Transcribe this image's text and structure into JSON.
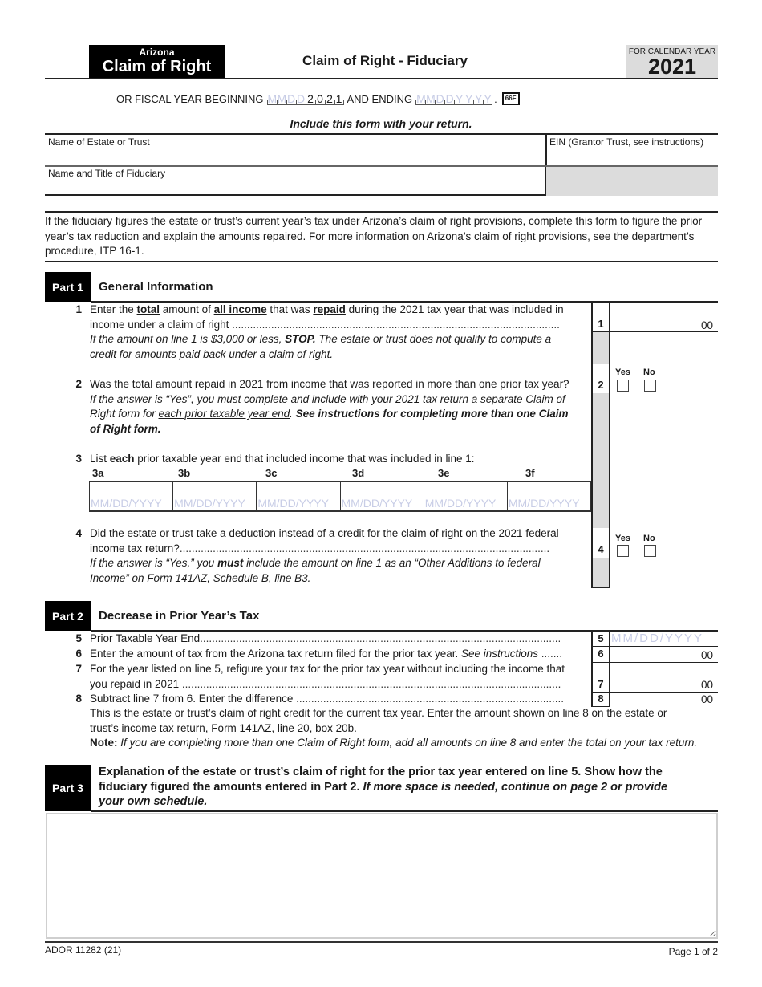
{
  "header": {
    "state": "Arizona",
    "form_name": "Claim of Right",
    "title": "Claim of Right - Fiduciary",
    "calendar_label": "FOR CALENDAR YEAR",
    "year": "2021"
  },
  "fiscal": {
    "beginning_label": "OR FISCAL YEAR BEGINNING",
    "beginning_placeholder": [
      "M",
      "M",
      "D",
      "D"
    ],
    "beginning_year": [
      "2",
      "0",
      "2",
      "1"
    ],
    "ending_label": "AND ENDING",
    "ending_placeholder": [
      "M",
      "M",
      "D",
      "D",
      "Y",
      "Y",
      "Y",
      "Y"
    ],
    "code": "66F"
  },
  "include_note": "Include this form with your return.",
  "identity": {
    "estate_label": "Name of Estate or Trust",
    "estate_value": "",
    "ein_label": "EIN (Grantor Trust, see instructions)",
    "ein_value": "",
    "fiduciary_label": "Name and Title of Fiduciary",
    "fiduciary_value": ""
  },
  "intro": "If the fiduciary figures the estate or trust’s current year’s tax under Arizona’s claim of right provisions, complete this form to figure the prior year’s tax reduction and explain the amounts repaired.  For more information on Arizona’s claim of right provisions, see the department’s procedure, ITP 16-1.",
  "part1": {
    "tag": "Part 1",
    "title": "General Information",
    "line1": {
      "num": "1",
      "t1": "Enter the ",
      "u1": "total",
      "t2": " amount of ",
      "u2": "all income",
      "t3": " that was ",
      "u3": "repaid",
      "t4": " during the 2021 tax year that was included in",
      "t5": "income under a claim of right",
      "dots": " .............................................................................................................",
      "note1": "If the amount on line 1 is $3,000 or less, ",
      "note_stop": "STOP.",
      "note2": "  The estate or trust does not qualify to compute a",
      "note3": "credit for amounts paid back under a claim of right.",
      "box": "1",
      "cents": "00",
      "value": ""
    },
    "line2": {
      "num": "2",
      "text": "Was the total amount repaid in 2021 from income that was reported in more than one prior tax year?",
      "i1": "If the answer is “Yes”, you must complete and include with your 2021 tax return a separate Claim of",
      "i2a": "Right form for ",
      "i2u": "each prior taxable year end",
      "i2b": ".  ",
      "i2bold": "See instructions for completing more than one Claim",
      "i3bold": "of Right form.",
      "box": "2",
      "yes": "Yes",
      "no": "No",
      "yes_checked": false,
      "no_checked": false
    },
    "line3": {
      "num": "3",
      "t1": "List ",
      "bold": "each",
      "t2": " prior taxable year end that included income that was included in line 1:",
      "columns": [
        {
          "label": "3a",
          "placeholder": "MM/DD/YYYY",
          "value": ""
        },
        {
          "label": "3b",
          "placeholder": "MM/DD/YYYY",
          "value": ""
        },
        {
          "label": "3c",
          "placeholder": "MM/DD/YYYY",
          "value": ""
        },
        {
          "label": "3d",
          "placeholder": "MM/DD/YYYY",
          "value": ""
        },
        {
          "label": "3e",
          "placeholder": "MM/DD/YYYY",
          "value": ""
        },
        {
          "label": "3f",
          "placeholder": "MM/DD/YYYY",
          "value": ""
        }
      ]
    },
    "line4": {
      "num": "4",
      "t1": "Did the estate or trust take a deduction instead of a credit for the claim of right on the 2021 federal",
      "t2": "income tax return?",
      "dots": "...........................................................................................................................",
      "i1a": "If the answer is “Yes,” you ",
      "i1b": "must",
      "i1c": " include the amount on line 1 as an “Other Additions to federal",
      "i2": "Income” on Form 141AZ, Schedule B, line B3.",
      "box": "4",
      "yes": "Yes",
      "no": "No",
      "yes_checked": false,
      "no_checked": false
    }
  },
  "part2": {
    "tag": "Part 2",
    "title": "Decrease in Prior Year’s Tax",
    "line5": {
      "num": "5",
      "text": "Prior Taxable Year End",
      "dots": "........................................................................................................................",
      "box": "5",
      "placeholder": "MM/DD/YYYY",
      "value": ""
    },
    "line6": {
      "num": "6",
      "text": "Enter the amount of tax from the Arizona tax return filed for the prior tax year.  ",
      "italic": "See instructions",
      "dots": " .......",
      "box": "6",
      "cents": "00",
      "value": ""
    },
    "line7": {
      "num": "7",
      "t1": "For the year listed on line 5, refigure your tax for the prior tax year without including the income that",
      "t2": "you repaid in 2021",
      "dots": " ..............................................................................................................................",
      "box": "7",
      "cents": "00",
      "value": ""
    },
    "line8": {
      "num": "8",
      "text": "Subtract line 7 from 6.  Enter the difference",
      "dots": " .........................................................................................",
      "box": "8",
      "cents": "00",
      "value": ""
    },
    "after1": "This is the estate or trust’s claim of right credit for the current tax year.  Enter the amount shown on line 8 on the estate or",
    "after2": "trust’s income tax return, Form 141AZ, line 20, box 20b.",
    "note_label": "Note:",
    "note_text": "  If you are completing more than one Claim of Right form, add all amounts on line 8 and enter the total on your tax return."
  },
  "part3": {
    "tag": "Part 3",
    "t1": "Explanation of the estate or trust’s claim of right for the prior tax year entered on line 5.  Show how the",
    "t2": "fiduciary figured the amounts entered in Part 2.  ",
    "t2i": "If more space is needed, continue on page 2 or provide",
    "t3i": "your own schedule.",
    "value": ""
  },
  "footer": {
    "form_id": "ADOR 11282 (21)",
    "page": "Page 1 of 2"
  }
}
